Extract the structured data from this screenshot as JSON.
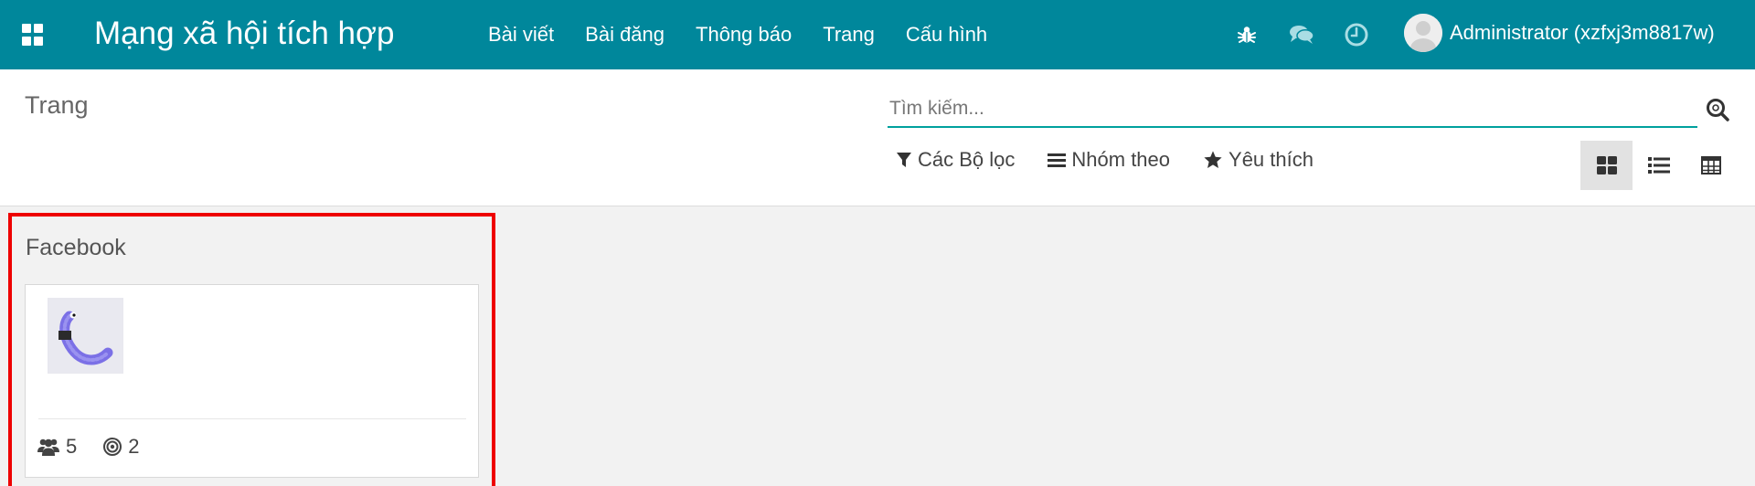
{
  "navbar": {
    "app_title": "Mạng xã hội tích hợp",
    "menu": [
      "Bài viết",
      "Bài đăng",
      "Thông báo",
      "Trang",
      "Cấu hình"
    ],
    "user_name": "Administrator (xzfxj3m8817w)",
    "icons": [
      "bug-icon",
      "chat-icon",
      "clock-icon"
    ]
  },
  "control": {
    "breadcrumb": "Trang",
    "search_placeholder": "Tìm kiếm...",
    "filters_label": "Các Bộ lọc",
    "groupby_label": "Nhóm theo",
    "favorites_label": "Yêu thích",
    "active_view": "kanban"
  },
  "kanban": {
    "group_title": "Facebook",
    "card": {
      "followers": "5",
      "posts": "2"
    }
  },
  "colors": {
    "navbar": "#00879b",
    "accent": "#00a09d",
    "highlight_border": "#ee0000"
  }
}
